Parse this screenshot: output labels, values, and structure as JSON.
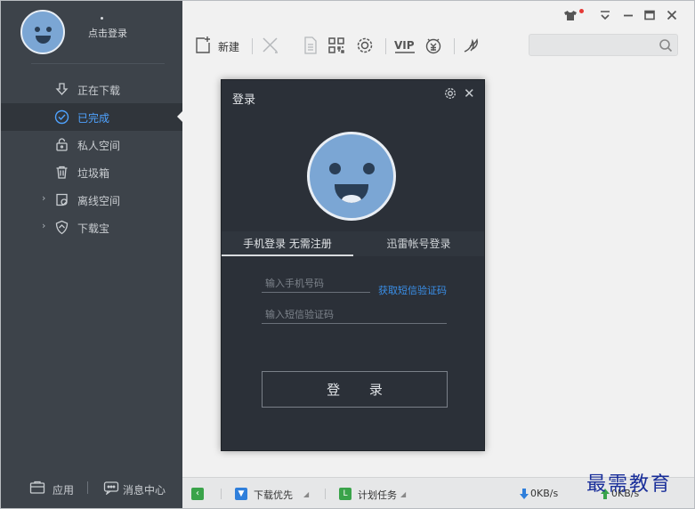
{
  "sidebar": {
    "login_label": "点击登录",
    "nav": [
      {
        "label": "正在下载",
        "icon": "download-icon",
        "active": false
      },
      {
        "label": "已完成",
        "icon": "check-circle-icon",
        "active": true
      },
      {
        "label": "私人空间",
        "icon": "lock-icon",
        "active": false
      },
      {
        "label": "垃圾箱",
        "icon": "trash-icon",
        "active": false
      },
      {
        "label": "离线空间",
        "icon": "offline-icon",
        "active": false
      },
      {
        "label": "下载宝",
        "icon": "shield-icon",
        "active": false
      }
    ],
    "bottom": {
      "apps_label": "应用",
      "messages_label": "消息中心"
    }
  },
  "titlebar": {
    "skin_icon": "shirt-icon",
    "menu_icon": "menu-icon",
    "minimize_icon": "minimize-icon",
    "maximize_icon": "maximize-icon",
    "close_icon": "close-icon"
  },
  "toolbar": {
    "new_label": "新建",
    "vip_label": "VIP",
    "search": {
      "value": "",
      "placeholder": ""
    }
  },
  "dialog": {
    "title": "登录",
    "tabs": [
      "手机登录 无需注册",
      "迅雷帐号登录"
    ],
    "phone_placeholder": "输入手机号码",
    "sms_link": "获取短信验证码",
    "code_placeholder": "输入短信验证码",
    "login_button": "登 录"
  },
  "statusbar": {
    "download_priority": "下载优先",
    "scheduled_tasks": "计划任务",
    "download_speed": "0KB/s",
    "upload_speed": "0KB/s"
  },
  "watermark": "最需教育",
  "colors": {
    "sidebar_bg": "#3d434a",
    "active_blue": "#4fa3ff",
    "dialog_bg": "#2b3038",
    "avatar_blue": "#7ba6d4",
    "link_blue": "#3a8fe8"
  }
}
